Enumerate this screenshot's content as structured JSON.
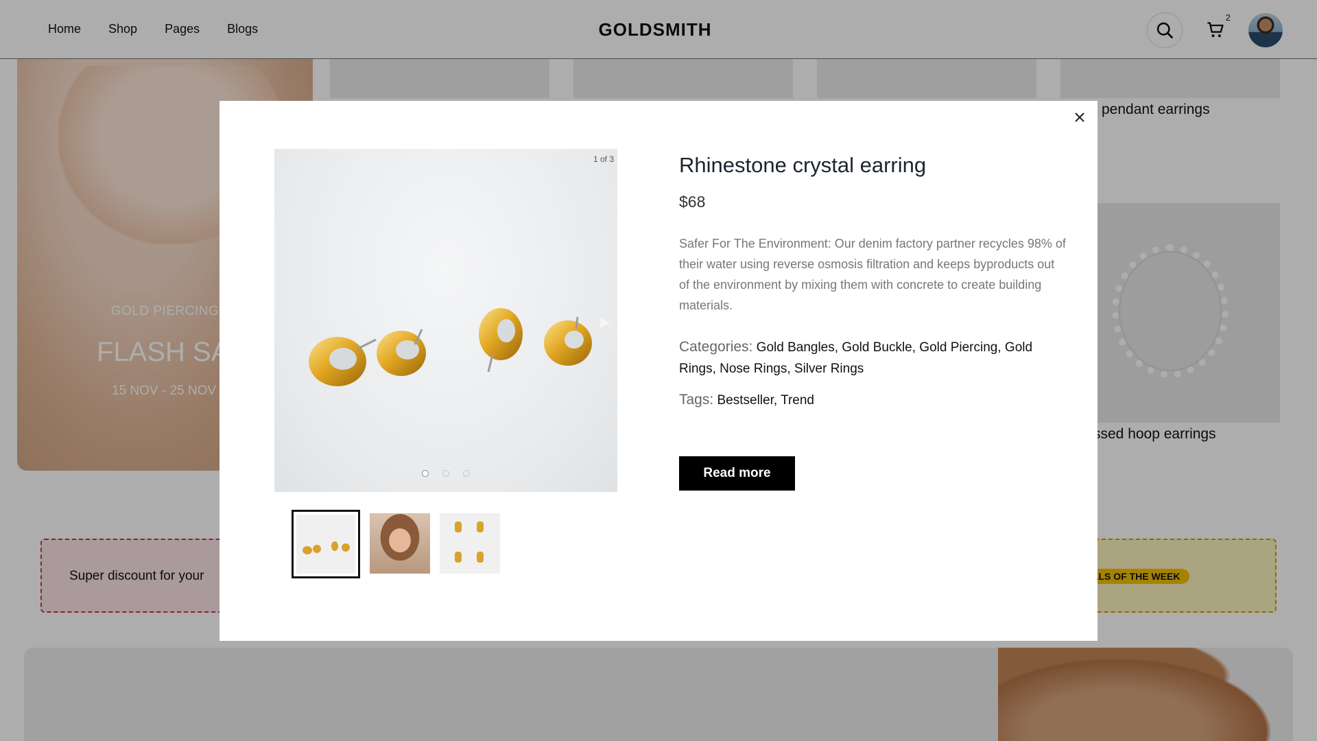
{
  "header": {
    "nav": [
      "Home",
      "Shop",
      "Pages",
      "Blogs"
    ],
    "logo": "GOLDSMITH",
    "cart_count": "2"
  },
  "background": {
    "banner": {
      "tag": "GOLD PIERCING",
      "title": "FLASH SAL",
      "date": "15 NOV - 25 NOV"
    },
    "pendant_label": "pendant earrings",
    "hoop_label": "ssed hoop earrings",
    "promo_left": "Super discount for your",
    "promo_right": "EALS OF THE WEEK"
  },
  "modal": {
    "image_counter": "1 of 3",
    "product": {
      "title": "Rhinestone crystal earring",
      "price": "$68",
      "description": "Safer For The Environment: Our denim factory partner recycles 98% of their water using reverse osmosis filtration and keeps byproducts out of the environment by mixing them with concrete to create building materials.",
      "categories_label": "Categories:",
      "categories": "Gold Bangles, Gold Buckle, Gold Piercing, Gold Rings, Nose Rings, Silver Rings",
      "tags_label": "Tags:",
      "tags": "Bestseller, Trend",
      "read_more": "Read more"
    },
    "carousel": {
      "total": 3,
      "active_index": 0
    },
    "thumbnails": [
      "earrings-product",
      "model-portrait",
      "earrings-grid"
    ]
  },
  "colors": {
    "accent": "#000000",
    "overlay": "rgba(0,0,0,0.32)",
    "promo_pink_border": "#c0394b",
    "promo_yellow": "#f4c200"
  }
}
